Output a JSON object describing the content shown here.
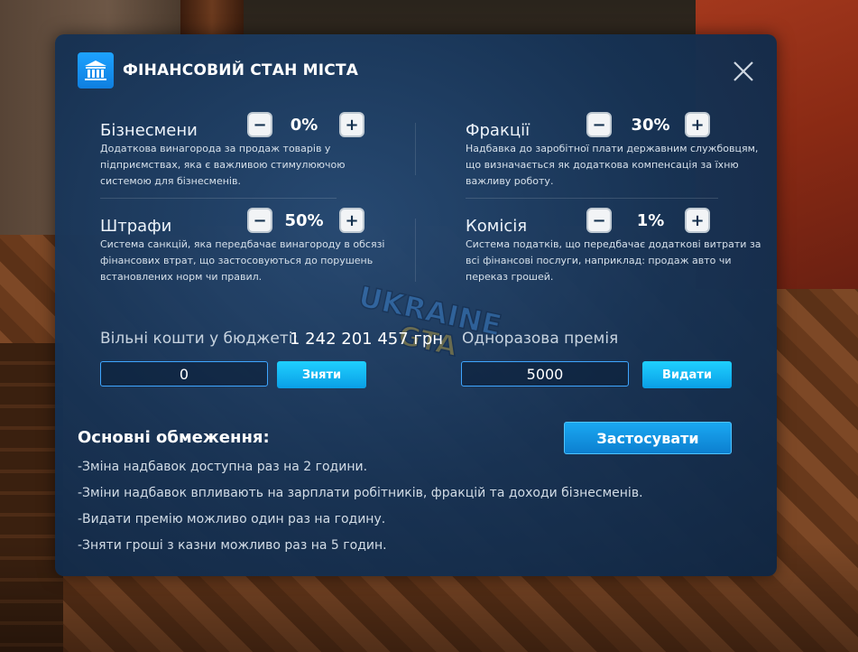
{
  "header": {
    "title": "ФІНАНСОВИЙ СТАН МІСТА"
  },
  "settings": [
    {
      "label": "Бізнесмени",
      "value": "0%",
      "description": "Додаткова винагорода за продаж товарів у підприємствах, яка є важливою стимулюючою системою для бізнесменів."
    },
    {
      "label": "Фракції",
      "value": "30%",
      "description": "Надбавка до заробітної плати державним службовцям, що визначається як додаткова компенсація за їхню важливу роботу."
    },
    {
      "label": "Штрафи",
      "value": "50%",
      "description": "Система санкцій, яка передбачає винагороду в обсязі фінансових втрат, що застосовуються до порушень встановлених норм чи правил."
    },
    {
      "label": "Комісія",
      "value": "1%",
      "description": "Система податків, що передбачає додаткові витрати за всі фінансові послуги, наприклад: продаж авто чи переказ грошей."
    }
  ],
  "budget": {
    "label": "Вільні кошти у бюджеті:",
    "amount": "1 242 201 457 грн",
    "withdraw_value": "0",
    "withdraw_button": "Зняти"
  },
  "bonus": {
    "label": "Одноразова премія",
    "value": "5000",
    "issue_button": "Видати"
  },
  "apply_button": "Застосувати",
  "limits": {
    "title": "Основні обмеження:",
    "items": [
      "-Зміна надбавок доступна раз на 2 години.",
      "-Зміни надбавок впливають на зарплати робітників, фракцій та доходи бізнесменів.",
      "-Видати премію можливо один раз на годину.",
      "-Зняти гроші з казни можливо раз на 5 годин."
    ]
  },
  "watermark": {
    "line1": "UKRAINE",
    "line2": "GTA"
  },
  "colors": {
    "accent": "#1aa8f2",
    "cyan": "#1fd0ff",
    "panel": "#1a3a5e"
  }
}
